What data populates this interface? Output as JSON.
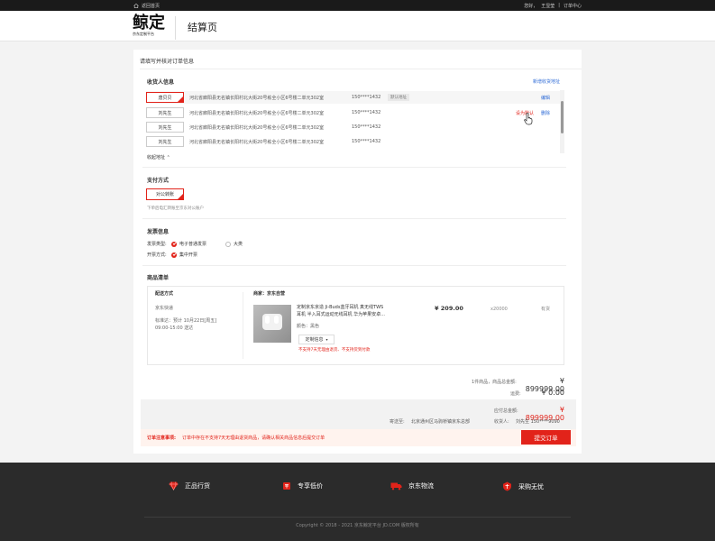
{
  "topbar": {
    "home": "返回首页",
    "greeting": "您好，",
    "username": "王显莹",
    "separator": "|",
    "orders": "订单中心"
  },
  "header": {
    "logo_big": "鲸定",
    "logo_small": "京东定制平台",
    "page_title": "结算页"
  },
  "notice": "请填写并核对订单信息",
  "receiver": {
    "title": "收货人信息",
    "add_link": "新增收货地址",
    "rows": [
      {
        "name": "唐贝贝",
        "address": "河北省廊阳县无名镇长阳村北大街20号栋全小区6号楼二单元302室",
        "phone": "150****1432",
        "tag": "默认地址",
        "actions": [
          "编辑"
        ]
      },
      {
        "name": "刘先生",
        "address": "河北省廊阳县无名镇长阳村北大街20号栋全小区6号楼二单元302室",
        "phone": "150****1432",
        "tag": "",
        "actions": [
          "设为默认",
          "删除"
        ]
      },
      {
        "name": "刘先生",
        "address": "河北省廊阳县无名镇长阳村北大街20号栋全小区6号楼二单元302室",
        "phone": "150****1432",
        "tag": "",
        "actions": []
      },
      {
        "name": "刘先生",
        "address": "河北省廊阳县无名镇长阳村北大街20号栋全小区6号楼二单元302室",
        "phone": "150****1432",
        "tag": "",
        "actions": []
      }
    ],
    "collapse": "收起地址"
  },
  "payment": {
    "title": "支付方式",
    "method": "对公转账",
    "hint": "下单后电汇转账至京东对公账户"
  },
  "invoice": {
    "title": "发票信息",
    "type_label": "发票类型:",
    "type_value": "电子普通发票",
    "type_alt": "大类",
    "mode_label": "开票方式:",
    "mode_value": "集中开票"
  },
  "goods": {
    "title": "商品清单",
    "ship_title": "配送方式",
    "ship_carrier": "京东快递",
    "ship_label": "标准达：预计 10月22日[周五]",
    "ship_time": "09:00-15:00 送达",
    "shop_label": "商家：",
    "shop_name": "京东自营",
    "product_line1": "定制京东京造 Ji-Buds蓝牙耳机 真无线TWS",
    "product_line2": "耳机 半入耳式运动无线耳机 华为苹果安卓...",
    "color": "颜色：黑色",
    "custom_btn": "定制信息",
    "warning": "不支持7天无理由退货、不支持货到付款",
    "price": "¥ 209.00",
    "qty": "x20000",
    "stock": "有货"
  },
  "summary": {
    "count_label": "1件商品，商品总金额:",
    "total": "¥ 899999.00",
    "freight_label": "运费:",
    "freight": "¥ 0.00",
    "payable_label": "应付总金额:",
    "payable": "¥ 899999.00",
    "ship_to_label": "寄送至:",
    "ship_to": "北京通州区马驹桥镇京东总部",
    "receiver_label": "收货人:",
    "receiver": "刘先生 150****9090"
  },
  "alert": {
    "label": "订单注意事项:",
    "text": "订单中存在不支持7天无理由退货商品，请确认相关商品信息后提交订单"
  },
  "submit": "提交订单",
  "footer": {
    "features": [
      "正品行货",
      "专享低价",
      "京东物流",
      "采购无忧"
    ],
    "copyright": "Copyright © 2018 - 2021 京东鲸定平台 JD.COM 版权所有"
  },
  "colors": {
    "brand_red": "#e2231a",
    "link_blue": "#2e6bd6",
    "footer_bg": "#2b2b2b"
  }
}
